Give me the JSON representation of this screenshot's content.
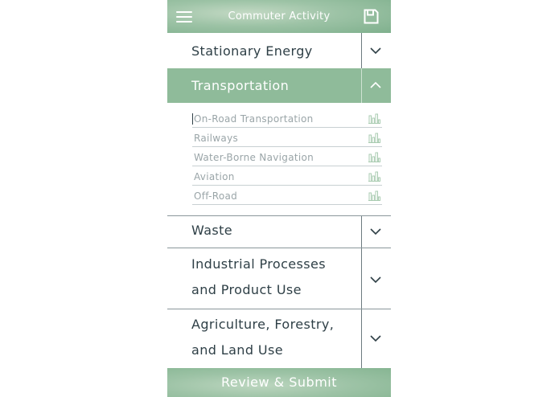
{
  "header": {
    "title": "Commuter Activity",
    "menu_icon": "hamburger-menu-icon",
    "save_icon": "save-icon"
  },
  "sections": [
    {
      "label": "Stationary Energy",
      "expanded": false
    },
    {
      "label": "Transportation",
      "expanded": true,
      "items": [
        {
          "label": "On-Road Transportation",
          "icon": "bar-chart-icon"
        },
        {
          "label": "Railways",
          "icon": "bar-chart-icon"
        },
        {
          "label": "Water-Borne Navigation",
          "icon": "bar-chart-icon"
        },
        {
          "label": "Aviation",
          "icon": "bar-chart-icon"
        },
        {
          "label": "Off-Road",
          "icon": "bar-chart-icon"
        }
      ]
    },
    {
      "label": "Waste",
      "expanded": false
    },
    {
      "label_line1": "Industrial Processes",
      "label_line2": "and Product Use",
      "expanded": false
    },
    {
      "label_line1": "Agriculture, Forestry,",
      "label_line2": "and Land Use",
      "expanded": false
    }
  ],
  "footer": {
    "submit_label": "Review & Submit"
  },
  "colors": {
    "accent": "#8fbb9a",
    "section_text": "#2e3f46",
    "sub_item_text": "#9aa5a8",
    "icon_green": "#a8cbb0"
  }
}
